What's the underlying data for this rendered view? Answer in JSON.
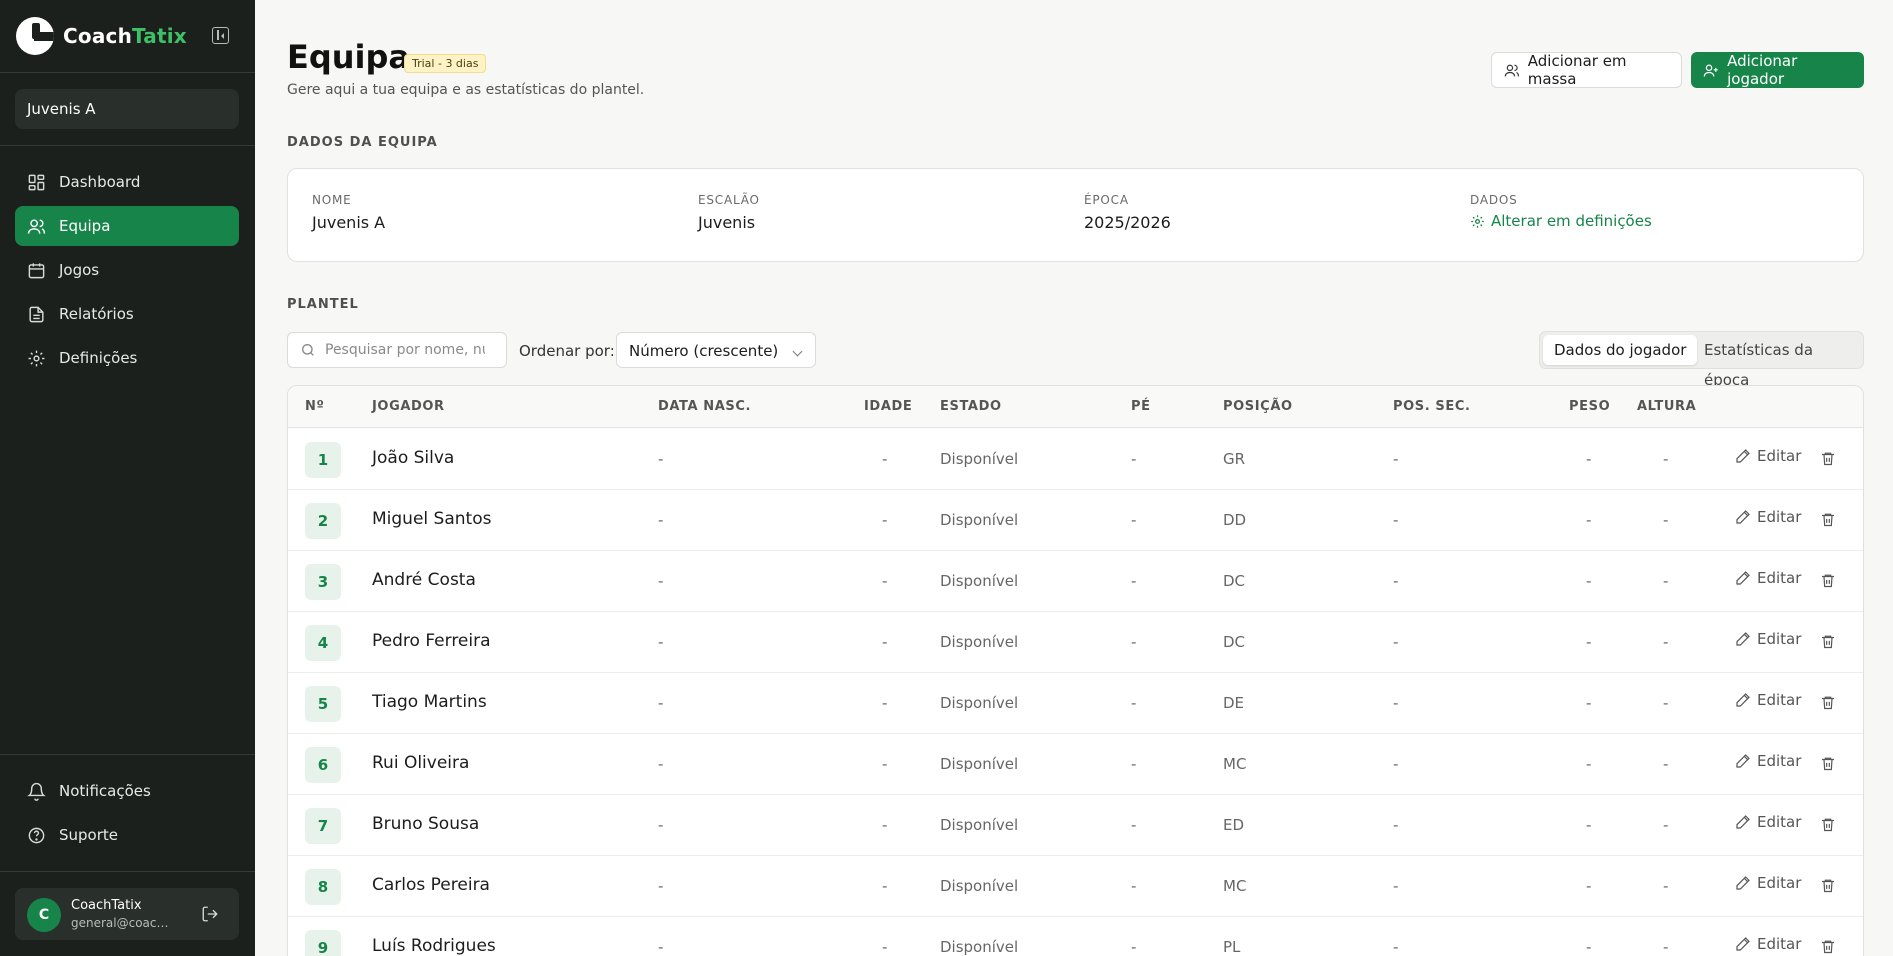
{
  "brand": {
    "name_part1": "Coach",
    "name_part2": "Tatix",
    "accent": "#3fc067"
  },
  "sidebar": {
    "team_selected": "Juvenis A",
    "nav": [
      {
        "label": "Dashboard",
        "icon": "dashboard-icon",
        "active": false
      },
      {
        "label": "Equipa",
        "icon": "users-icon",
        "active": true
      },
      {
        "label": "Jogos",
        "icon": "calendar-icon",
        "active": false
      },
      {
        "label": "Relatórios",
        "icon": "report-icon",
        "active": false
      },
      {
        "label": "Definições",
        "icon": "gear-icon",
        "active": false
      }
    ],
    "bottom_nav": [
      {
        "label": "Notificações",
        "icon": "bell-icon"
      },
      {
        "label": "Suporte",
        "icon": "help-circle-icon"
      }
    ],
    "user": {
      "initial": "C",
      "name": "CoachTatix",
      "email": "general@coachtatix.com"
    }
  },
  "header": {
    "title": "Equipa",
    "badge": "Trial - 3 dias",
    "subtitle": "Gere aqui a tua equipa e as estatísticas do plantel.",
    "bulk_add_label": "Adicionar em massa",
    "add_player_label": "Adicionar jogador"
  },
  "team_data": {
    "section_title": "DADOS DA EQUIPA",
    "name_label": "NOME",
    "name_value": "Juvenis A",
    "level_label": "ESCALÃO",
    "level_value": "Juvenis",
    "season_label": "ÉPOCA",
    "season_value": "2025/2026",
    "data_label": "DADOS",
    "settings_link": "Alterar em definições"
  },
  "roster": {
    "section_title": "PLANTEL",
    "search_placeholder": "Pesquisar por nome, número...",
    "sort_label": "Ordenar por:",
    "sort_value": "Número (crescente)",
    "view_options": [
      "Dados do jogador",
      "Estatísticas da época"
    ],
    "active_view": 0,
    "columns": [
      "Nº",
      "JOGADOR",
      "DATA NASC.",
      "IDADE",
      "ESTADO",
      "PÉ",
      "POSIÇÃO",
      "POS. SEC.",
      "PESO",
      "ALTURA"
    ],
    "edit_label": "Editar",
    "players": [
      {
        "number": "1",
        "name": "João Silva",
        "birth": "-",
        "age": "-",
        "status": "Disponível",
        "foot": "-",
        "position": "GR",
        "secondary": "-",
        "weight": "-",
        "height": "-"
      },
      {
        "number": "2",
        "name": "Miguel Santos",
        "birth": "-",
        "age": "-",
        "status": "Disponível",
        "foot": "-",
        "position": "DD",
        "secondary": "-",
        "weight": "-",
        "height": "-"
      },
      {
        "number": "3",
        "name": "André Costa",
        "birth": "-",
        "age": "-",
        "status": "Disponível",
        "foot": "-",
        "position": "DC",
        "secondary": "-",
        "weight": "-",
        "height": "-"
      },
      {
        "number": "4",
        "name": "Pedro Ferreira",
        "birth": "-",
        "age": "-",
        "status": "Disponível",
        "foot": "-",
        "position": "DC",
        "secondary": "-",
        "weight": "-",
        "height": "-"
      },
      {
        "number": "5",
        "name": "Tiago Martins",
        "birth": "-",
        "age": "-",
        "status": "Disponível",
        "foot": "-",
        "position": "DE",
        "secondary": "-",
        "weight": "-",
        "height": "-"
      },
      {
        "number": "6",
        "name": "Rui Oliveira",
        "birth": "-",
        "age": "-",
        "status": "Disponível",
        "foot": "-",
        "position": "MC",
        "secondary": "-",
        "weight": "-",
        "height": "-"
      },
      {
        "number": "7",
        "name": "Bruno Sousa",
        "birth": "-",
        "age": "-",
        "status": "Disponível",
        "foot": "-",
        "position": "ED",
        "secondary": "-",
        "weight": "-",
        "height": "-"
      },
      {
        "number": "8",
        "name": "Carlos Pereira",
        "birth": "-",
        "age": "-",
        "status": "Disponível",
        "foot": "-",
        "position": "MC",
        "secondary": "-",
        "weight": "-",
        "height": "-"
      },
      {
        "number": "9",
        "name": "Luís Rodrigues",
        "birth": "-",
        "age": "-",
        "status": "Disponível",
        "foot": "-",
        "position": "PL",
        "secondary": "-",
        "weight": "-",
        "height": "-"
      }
    ]
  },
  "colors": {
    "primary": "#17854a",
    "sidebar_bg": "#1b201c",
    "page_bg": "#f7f7f5"
  }
}
